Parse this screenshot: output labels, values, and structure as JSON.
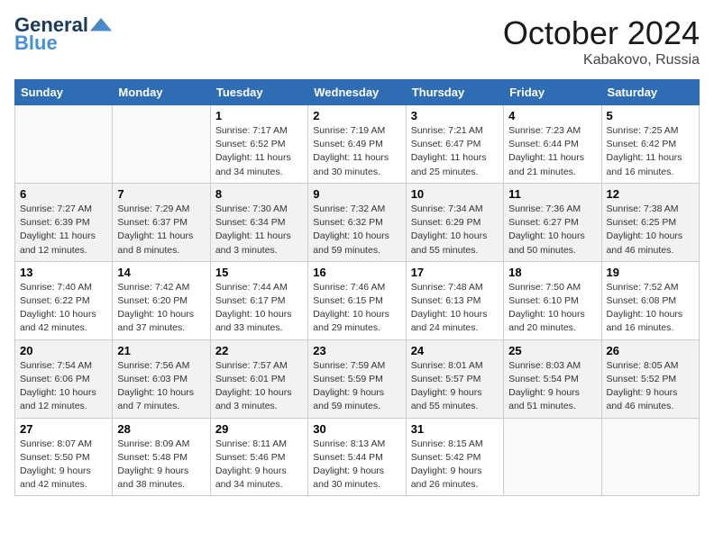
{
  "header": {
    "logo_line1": "General",
    "logo_line2": "Blue",
    "month": "October 2024",
    "location": "Kabakovo, Russia"
  },
  "days_of_week": [
    "Sunday",
    "Monday",
    "Tuesday",
    "Wednesday",
    "Thursday",
    "Friday",
    "Saturday"
  ],
  "weeks": [
    [
      {
        "day": "",
        "info": ""
      },
      {
        "day": "",
        "info": ""
      },
      {
        "day": "1",
        "info": "Sunrise: 7:17 AM\nSunset: 6:52 PM\nDaylight: 11 hours and 34 minutes."
      },
      {
        "day": "2",
        "info": "Sunrise: 7:19 AM\nSunset: 6:49 PM\nDaylight: 11 hours and 30 minutes."
      },
      {
        "day": "3",
        "info": "Sunrise: 7:21 AM\nSunset: 6:47 PM\nDaylight: 11 hours and 25 minutes."
      },
      {
        "day": "4",
        "info": "Sunrise: 7:23 AM\nSunset: 6:44 PM\nDaylight: 11 hours and 21 minutes."
      },
      {
        "day": "5",
        "info": "Sunrise: 7:25 AM\nSunset: 6:42 PM\nDaylight: 11 hours and 16 minutes."
      }
    ],
    [
      {
        "day": "6",
        "info": "Sunrise: 7:27 AM\nSunset: 6:39 PM\nDaylight: 11 hours and 12 minutes."
      },
      {
        "day": "7",
        "info": "Sunrise: 7:29 AM\nSunset: 6:37 PM\nDaylight: 11 hours and 8 minutes."
      },
      {
        "day": "8",
        "info": "Sunrise: 7:30 AM\nSunset: 6:34 PM\nDaylight: 11 hours and 3 minutes."
      },
      {
        "day": "9",
        "info": "Sunrise: 7:32 AM\nSunset: 6:32 PM\nDaylight: 10 hours and 59 minutes."
      },
      {
        "day": "10",
        "info": "Sunrise: 7:34 AM\nSunset: 6:29 PM\nDaylight: 10 hours and 55 minutes."
      },
      {
        "day": "11",
        "info": "Sunrise: 7:36 AM\nSunset: 6:27 PM\nDaylight: 10 hours and 50 minutes."
      },
      {
        "day": "12",
        "info": "Sunrise: 7:38 AM\nSunset: 6:25 PM\nDaylight: 10 hours and 46 minutes."
      }
    ],
    [
      {
        "day": "13",
        "info": "Sunrise: 7:40 AM\nSunset: 6:22 PM\nDaylight: 10 hours and 42 minutes."
      },
      {
        "day": "14",
        "info": "Sunrise: 7:42 AM\nSunset: 6:20 PM\nDaylight: 10 hours and 37 minutes."
      },
      {
        "day": "15",
        "info": "Sunrise: 7:44 AM\nSunset: 6:17 PM\nDaylight: 10 hours and 33 minutes."
      },
      {
        "day": "16",
        "info": "Sunrise: 7:46 AM\nSunset: 6:15 PM\nDaylight: 10 hours and 29 minutes."
      },
      {
        "day": "17",
        "info": "Sunrise: 7:48 AM\nSunset: 6:13 PM\nDaylight: 10 hours and 24 minutes."
      },
      {
        "day": "18",
        "info": "Sunrise: 7:50 AM\nSunset: 6:10 PM\nDaylight: 10 hours and 20 minutes."
      },
      {
        "day": "19",
        "info": "Sunrise: 7:52 AM\nSunset: 6:08 PM\nDaylight: 10 hours and 16 minutes."
      }
    ],
    [
      {
        "day": "20",
        "info": "Sunrise: 7:54 AM\nSunset: 6:06 PM\nDaylight: 10 hours and 12 minutes."
      },
      {
        "day": "21",
        "info": "Sunrise: 7:56 AM\nSunset: 6:03 PM\nDaylight: 10 hours and 7 minutes."
      },
      {
        "day": "22",
        "info": "Sunrise: 7:57 AM\nSunset: 6:01 PM\nDaylight: 10 hours and 3 minutes."
      },
      {
        "day": "23",
        "info": "Sunrise: 7:59 AM\nSunset: 5:59 PM\nDaylight: 9 hours and 59 minutes."
      },
      {
        "day": "24",
        "info": "Sunrise: 8:01 AM\nSunset: 5:57 PM\nDaylight: 9 hours and 55 minutes."
      },
      {
        "day": "25",
        "info": "Sunrise: 8:03 AM\nSunset: 5:54 PM\nDaylight: 9 hours and 51 minutes."
      },
      {
        "day": "26",
        "info": "Sunrise: 8:05 AM\nSunset: 5:52 PM\nDaylight: 9 hours and 46 minutes."
      }
    ],
    [
      {
        "day": "27",
        "info": "Sunrise: 8:07 AM\nSunset: 5:50 PM\nDaylight: 9 hours and 42 minutes."
      },
      {
        "day": "28",
        "info": "Sunrise: 8:09 AM\nSunset: 5:48 PM\nDaylight: 9 hours and 38 minutes."
      },
      {
        "day": "29",
        "info": "Sunrise: 8:11 AM\nSunset: 5:46 PM\nDaylight: 9 hours and 34 minutes."
      },
      {
        "day": "30",
        "info": "Sunrise: 8:13 AM\nSunset: 5:44 PM\nDaylight: 9 hours and 30 minutes."
      },
      {
        "day": "31",
        "info": "Sunrise: 8:15 AM\nSunset: 5:42 PM\nDaylight: 9 hours and 26 minutes."
      },
      {
        "day": "",
        "info": ""
      },
      {
        "day": "",
        "info": ""
      }
    ]
  ]
}
